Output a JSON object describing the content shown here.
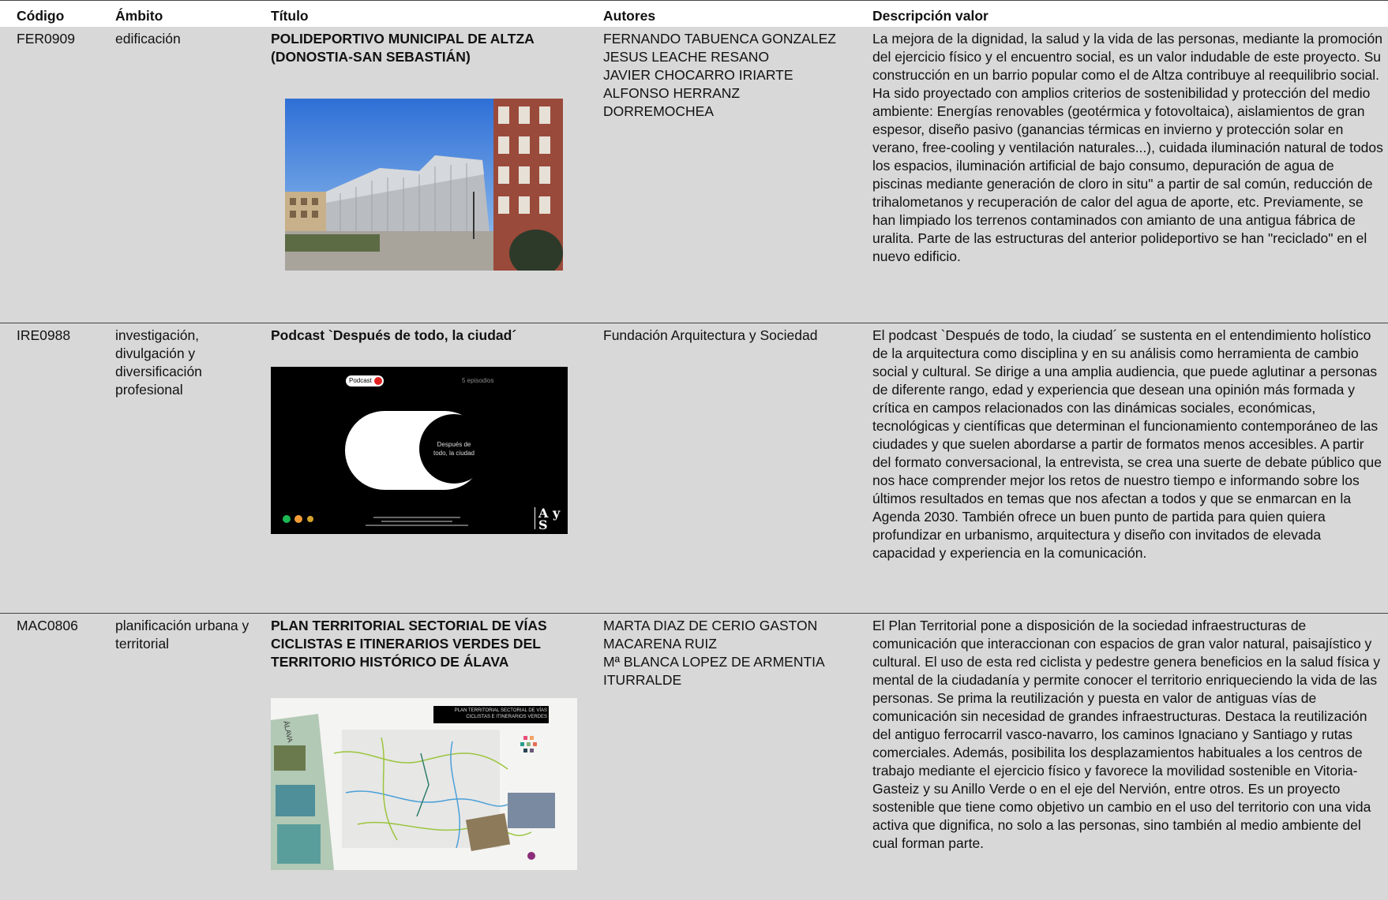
{
  "headers": {
    "codigo": "Código",
    "ambito": "Ámbito",
    "titulo": "Título",
    "autores": "Autores",
    "descripcion": "Descripción valor"
  },
  "rows": [
    {
      "codigo": "FER0909",
      "ambito": "edificación",
      "titulo": "POLIDEPORTIVO MUNICIPAL DE ALTZA (DONOSTIA-SAN SEBASTIÁN)",
      "autores": [
        "FERNANDO TABUENCA GONZALEZ",
        "JESUS LEACHE RESANO",
        "JAVIER CHOCARRO IRIARTE",
        "ALFONSO HERRANZ",
        "DORREMOCHEA"
      ],
      "descripcion": "La mejora de la dignidad, la salud y la vida de las personas, mediante la promoción del ejercicio físico y el encuentro social, es un valor indudable de este proyecto. Su construcción en un barrio popular como el de Altza contribuye al reequilibrio social. Ha sido proyectado con amplios criterios de sostenibilidad y protección del medio ambiente: Energías renovables (geotérmica y fotovoltaica), aislamientos de gran espesor, diseño pasivo (ganancias térmicas en invierno y protección solar en verano, free-cooling y ventilación naturales...), cuidada iluminación natural de todos los espacios, iluminación artificial de bajo consumo, depuración de agua de piscinas mediante generación de cloro in situ\" a partir de sal común, reducción de trihalometanos y recuperación de calor del agua de aporte, etc. Previamente, se han limpiado los terrenos contaminados con amianto de una antigua fábrica de uralita.  Parte de las estructuras del anterior polideportivo se han \"reciclado\" en el nuevo edificio."
    },
    {
      "codigo": "IRE0988",
      "ambito": "investigación, divulgación y diversificación profesional",
      "titulo": "Podcast `Después de todo, la ciudad´",
      "autores": [
        "Fundación Arquitectura y Sociedad"
      ],
      "descripcion": "El podcast `Después de todo, la ciudad´ se sustenta en el entendimiento holístico de la arquitectura como disciplina y en su análisis como herramienta de cambio social y cultural. Se dirige a una amplia audiencia, que puede aglutinar a personas de diferente rango, edad y experiencia que desean una opinión más formada y crítica en campos relacionados con las dinámicas sociales, económicas, tecnológicas y científicas que determinan el funcionamiento contemporáneo de las ciudades y que suelen abordarse a partir de formatos menos accesibles. A partir del formato conversacional, la entrevista, se crea una suerte de debate público que nos hace comprender mejor los retos de nuestro tiempo e informando sobre los últimos resultados en temas que nos afectan a todos y que se enmarcan en la Agenda 2030. También ofrece un buen punto de partida para quien quiera profundizar en urbanismo, arquitectura y diseño con invitados de elevada capacidad y experiencia en la comunicación.",
      "image": {
        "badge": "Podcast",
        "episodes": "5 episodios",
        "circle_text": "Después de todo, la ciudad",
        "logo": "A y S"
      }
    },
    {
      "codigo": "MAC0806",
      "ambito": "planificación urbana y territorial",
      "titulo": "PLAN TERRITORIAL SECTORIAL DE VÍAS CICLISTAS E ITINERARIOS VERDES DEL TERRITORIO HISTÓRICO DE ÁLAVA",
      "autores": [
        "MARTA DIAZ DE CERIO GASTON",
        "MACARENA RUIZ",
        "Mª BLANCA LOPEZ DE ARMENTIA",
        "ITURRALDE"
      ],
      "descripcion": "El Plan Territorial pone a disposición de la sociedad infraestructuras de comunicación que interaccionan con espacios de gran valor natural, paisajístico y cultural. El uso de esta red ciclista y pedestre genera beneficios en la salud física y mental de la ciudadanía y permite conocer el territorio enriqueciendo la vida de las personas. Se prima la reutilización y puesta en valor de antiguas vías de comunicación sin necesidad de grandes infraestructuras. Destaca la reutilización del antiguo ferrocarril vasco-navarro, los caminos Ignaciano y Santiago y rutas comerciales. Además, posibilita los desplazamientos habituales a los centros de trabajo mediante el ejercicio físico y favorece la movilidad sostenible en Vitoria-Gasteiz y su Anillo Verde o en el eje del Nervión, entre otros. Es un proyecto sostenible que tiene como objetivo un cambio en el uso del territorio con una vida activa que dignifica, no solo a las personas, sino también al medio ambiente del cual forman parte.",
      "image": {
        "side_label": "ÁLAVA",
        "panel_title": "PLAN TERRITORIAL SECTORIAL DE VÍAS CICLISTAS E ITINERARIOS VERDES"
      }
    }
  ]
}
